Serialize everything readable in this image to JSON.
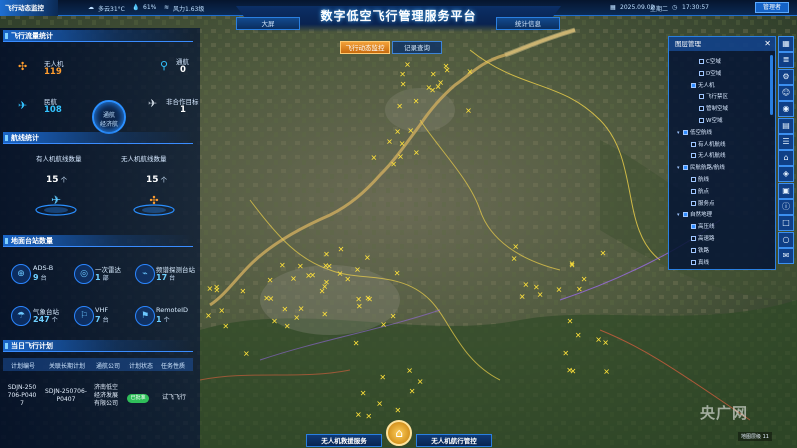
{
  "topbar": {
    "mode_label": "飞行动态监控",
    "weather": "多云31°C",
    "humidity": "61%",
    "wind": "风力1.63级",
    "date": "2025.09.02",
    "weekday": "星期二",
    "time": "17:30:57",
    "admin_label": "管理者"
  },
  "header": {
    "title": "数字低空飞行管理服务平台",
    "nav_left": "大屏",
    "nav_right": "统计信息"
  },
  "tabs": {
    "active": "飞行动态监控",
    "other": "记录查询"
  },
  "flight_stats": {
    "heading": "飞行流量统计",
    "uav_label": "无人机",
    "uav_value": "119",
    "general_label": "通航",
    "general_value": "0",
    "civil_label": "民航",
    "civil_value": "108",
    "noncoop_label": "非合作目标",
    "noncoop_value": "1",
    "center_label": "通航",
    "center_sub": "经济航"
  },
  "route_stats": {
    "heading": "航线统计",
    "manned_label": "有人机航线数量",
    "manned_value": "15",
    "manned_unit": "个",
    "uav_label": "无人机航线数量",
    "uav_value": "15",
    "uav_unit": "个"
  },
  "ground_stations": {
    "heading": "地面台站数量",
    "items": [
      {
        "label": "ADS-B",
        "value": "9",
        "unit": "台"
      },
      {
        "label": "一次雷达",
        "value": "1",
        "unit": "部"
      },
      {
        "label": "频谱探测台站",
        "value": "17",
        "unit": "台"
      },
      {
        "label": "气象台站",
        "value": "247",
        "unit": "个"
      },
      {
        "label": "VHF",
        "value": "7",
        "unit": "台"
      },
      {
        "label": "RemoteID",
        "value": "1",
        "unit": "个"
      }
    ]
  },
  "flight_plan": {
    "heading": "当日飞行计划",
    "columns": [
      "计划编号",
      "关联长期计划",
      "通航公司",
      "计划状态",
      "任务性质"
    ],
    "row": {
      "plan_id": "SDJN-250706-P0407",
      "long_term": "SDJN-250706-P0407",
      "company": "济南低空经济发展有限公司",
      "status": "已批准",
      "task": "试飞飞行"
    }
  },
  "layer_panel": {
    "title": "图层管理",
    "rows": [
      {
        "label": "C空域",
        "indent": 5,
        "checked": false
      },
      {
        "label": "D空域",
        "indent": 5,
        "checked": false
      },
      {
        "label": "无人机",
        "indent": 3,
        "checked": true
      },
      {
        "label": "飞行禁区",
        "indent": 5,
        "checked": false
      },
      {
        "label": "管制空域",
        "indent": 5,
        "checked": false
      },
      {
        "label": "W空域",
        "indent": 5,
        "checked": false
      },
      {
        "label": "低空航线",
        "indent": 1,
        "checked": true
      },
      {
        "label": "有人机航线",
        "indent": 3,
        "checked": false
      },
      {
        "label": "无人机航线",
        "indent": 3,
        "checked": false
      },
      {
        "label": "民航航路/航线",
        "indent": 1,
        "checked": true
      },
      {
        "label": "航线",
        "indent": 3,
        "checked": false
      },
      {
        "label": "航点",
        "indent": 3,
        "checked": false
      },
      {
        "label": "服务点",
        "indent": 3,
        "checked": false
      },
      {
        "label": "自然地理",
        "indent": 1,
        "checked": true
      },
      {
        "label": "高压线",
        "indent": 3,
        "checked": true
      },
      {
        "label": "高速路",
        "indent": 3,
        "checked": false
      },
      {
        "label": "铁路",
        "indent": 3,
        "checked": false
      },
      {
        "label": "真线",
        "indent": 3,
        "checked": false
      }
    ]
  },
  "toolbar": {
    "icons": [
      "grid-icon",
      "layers-icon",
      "gear-icon",
      "user-icon",
      "eye-icon",
      "map-icon",
      "list-icon",
      "home-icon",
      "tag-icon",
      "box-icon",
      "info-icon",
      "square-icon",
      "circle-icon",
      "chat-icon"
    ]
  },
  "bottom": {
    "left_tab": "无人机救援服务",
    "right_tab": "无人机航行管控",
    "watermark": "央广网",
    "map_credit": "地图层级 11"
  },
  "colors": {
    "accent": "#2a7fe0",
    "orange": "#ff9d2e",
    "cyan": "#33c3ff",
    "status_green": "#2fbf5a",
    "marker_yellow": "#ffe23a"
  }
}
